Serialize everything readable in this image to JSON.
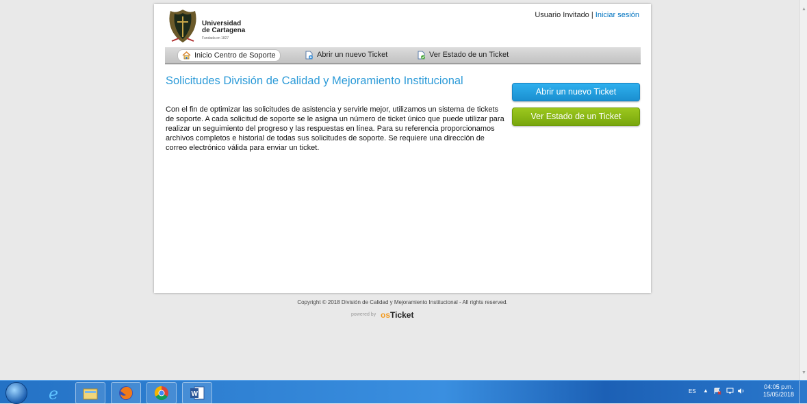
{
  "header": {
    "logo_line1": "Universidad",
    "logo_line2": "de Cartagena",
    "logo_sub": "Fundada en 1827",
    "user_label": "Usuario Invitado",
    "separator": "|",
    "login_link": "Iniciar sesión"
  },
  "nav": [
    {
      "label": "Inicio Centro de Soporte",
      "icon": "home-icon",
      "active": true
    },
    {
      "label": "Abrir un nuevo Ticket",
      "icon": "new-ticket-icon",
      "active": false
    },
    {
      "label": "Ver Estado de un Ticket",
      "icon": "ticket-status-icon",
      "active": false
    }
  ],
  "main": {
    "title": "Solicitudes División de Calidad y Mejoramiento Institucional",
    "intro": "Con el fin de optimizar las solicitudes de asistencia y servirle mejor, utilizamos un sistema de tickets de soporte. A cada solicitud de soporte se le asigna un número de ticket único que puede utilizar para realizar un seguimiento del progreso y las respuestas en línea. Para su referencia proporcionamos archivos completos e historial de todas sus solicitudes de soporte. Se requiere una dirección de correo electrónico válida para enviar un ticket.",
    "btn_open": "Abrir un nuevo Ticket",
    "btn_status": "Ver Estado de un Ticket"
  },
  "footer": {
    "copyright": "Copyright © 2018 División de Calidad y Mejoramiento Institucional - All rights reserved.",
    "powered_by": "powered by",
    "powered_brand_os": "os",
    "powered_brand_ticket": "Ticket"
  },
  "taskbar": {
    "apps": [
      "internet-explorer-icon",
      "file-explorer-icon",
      "firefox-icon",
      "chrome-icon",
      "word-icon"
    ],
    "lang": "ES",
    "time": "04:05 p.m.",
    "date": "15/05/2018"
  },
  "colors": {
    "title_blue": "#2d9bd8",
    "link_blue": "#0073c0",
    "button_blue": "#1a8fd0",
    "button_green": "#78a60c",
    "taskbar_blue": "#2472c5"
  }
}
